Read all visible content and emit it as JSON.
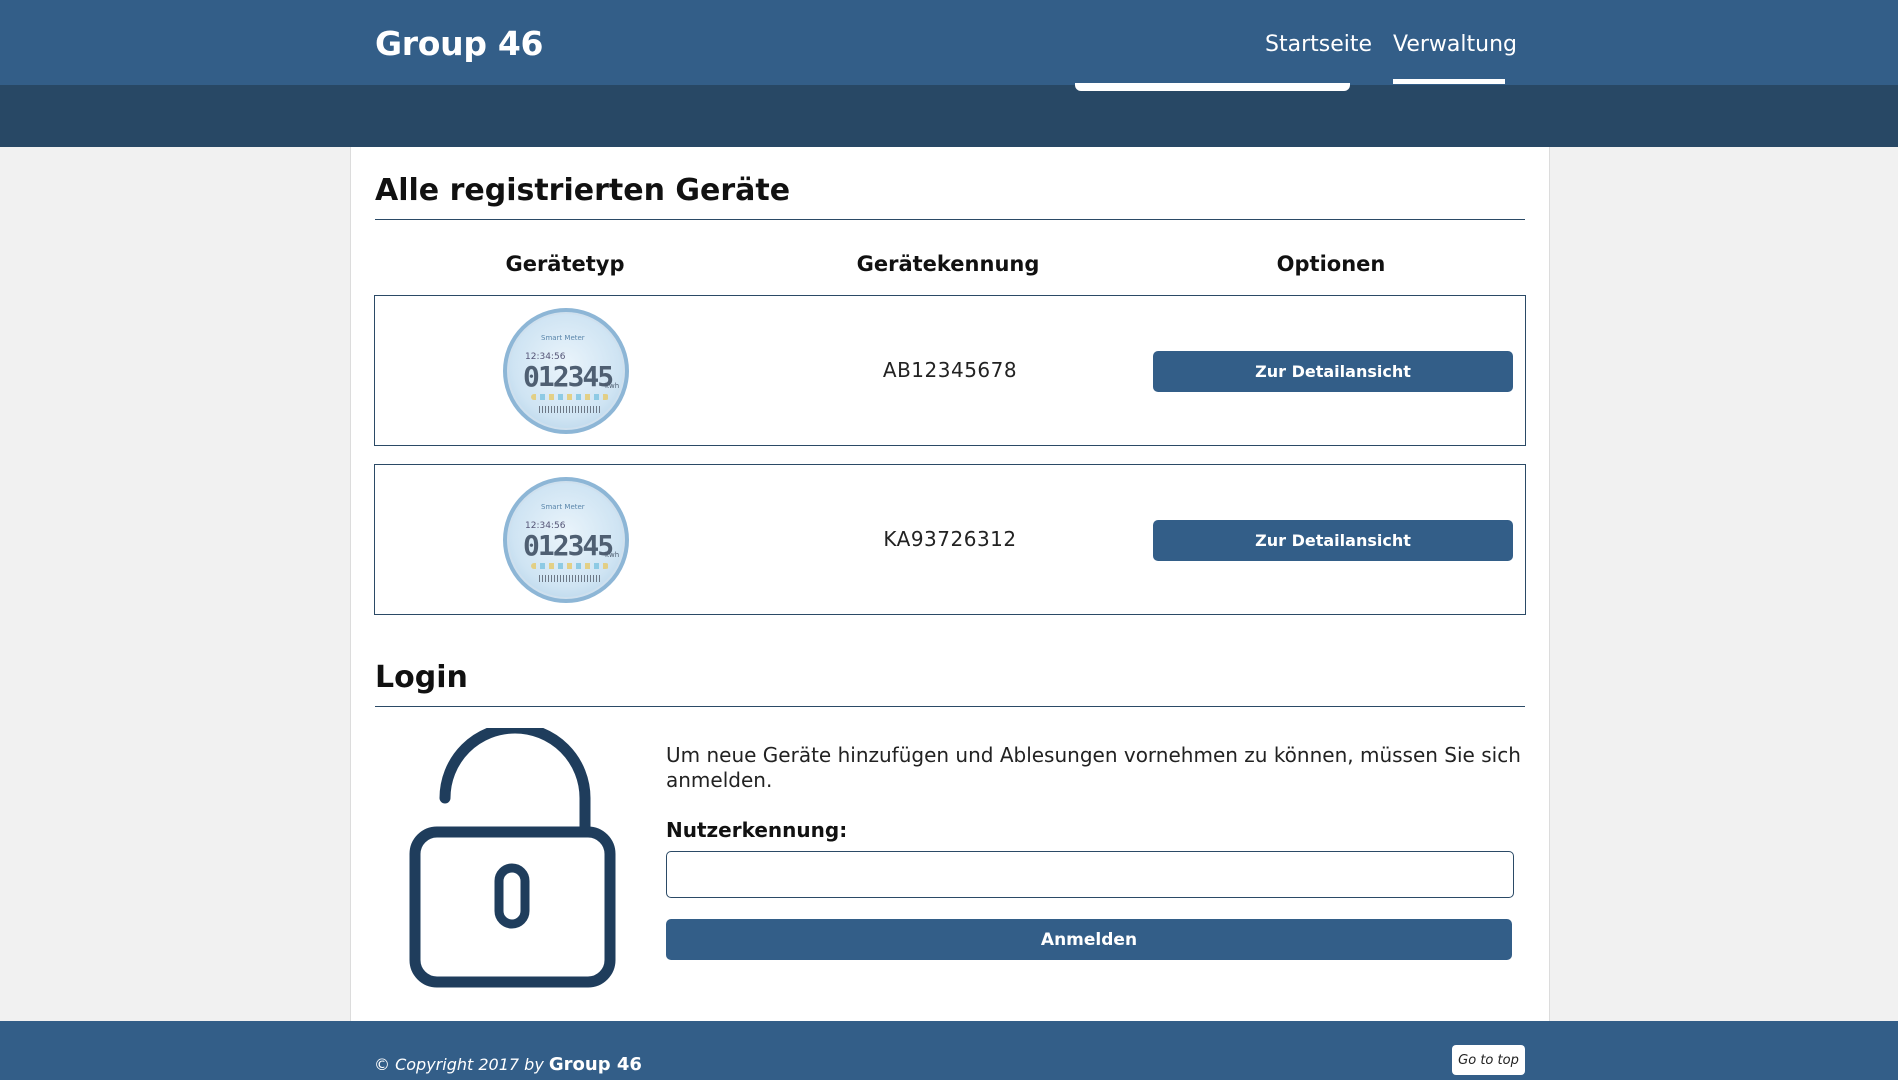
{
  "header": {
    "brand": "Group 46",
    "nav": [
      {
        "label": "Startseite",
        "active": false
      },
      {
        "label": "Verwaltung",
        "active": true
      }
    ]
  },
  "devices_section": {
    "title": "Alle registrierten Geräte",
    "columns": [
      "Gerätetyp",
      "Gerätekennung",
      "Optionen"
    ],
    "rows": [
      {
        "image": "smart-meter",
        "meter": {
          "brand": "Smart Meter",
          "time": "12:34:56",
          "value": "012345",
          "unit": "kwh"
        },
        "id": "AB12345678",
        "action_label": "Zur Detailansicht"
      },
      {
        "image": "smart-meter",
        "meter": {
          "brand": "Smart Meter",
          "time": "12:34:56",
          "value": "012345",
          "unit": "kwh"
        },
        "id": "KA93726312",
        "action_label": "Zur Detailansicht"
      }
    ]
  },
  "login_section": {
    "title": "Login",
    "icon": "unlocked-padlock-icon",
    "description": "Um neue Geräte hinzufügen und Ablesungen vornehmen zu können, müssen Sie sich anmelden.",
    "field_label": "Nutzerkennung:",
    "field_value": "",
    "field_placeholder": "",
    "submit_label": "Anmelden"
  },
  "footer": {
    "copyright_prefix": "© Copyright 2017 by",
    "copyright_brand": "Group 46",
    "go_to_top_label": "Go to top"
  },
  "colors": {
    "primary": "#335e88",
    "primary_dark": "#284865",
    "background": "#f1f1f1",
    "panel": "#ffffff"
  }
}
